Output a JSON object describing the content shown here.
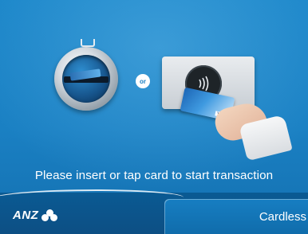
{
  "screen": {
    "prompt": "Please insert or tap card to start transaction",
    "separator_label": "or"
  },
  "brand": {
    "name": "ANZ"
  },
  "actions": {
    "cardless_label": "Cardless"
  },
  "card": {
    "network_label": "VISA"
  },
  "icons": {
    "card_reader": "card-reader-icon",
    "contactless": "contactless-icon",
    "hand_with_card": "hand-card-icon",
    "logo": "anz-logo"
  },
  "colors": {
    "background": "#1a80c3",
    "bar": "#0d4f84",
    "button": "#177ec2",
    "text": "#ffffff"
  }
}
